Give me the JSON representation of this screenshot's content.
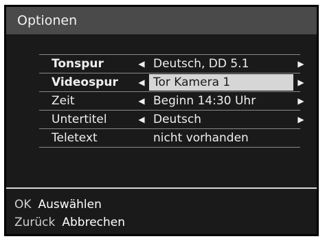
{
  "window": {
    "title": "Optionen"
  },
  "options": [
    {
      "label": "Tonspur",
      "value": "Deutsch, DD 5.1",
      "bold": true
    },
    {
      "label": "Videospur",
      "value": "Tor Kamera 1",
      "bold": true,
      "selected": true
    },
    {
      "label": "Zeit",
      "value": "Beginn 14:30 Uhr",
      "bold": false
    },
    {
      "label": "Untertitel",
      "value": "Deutsch",
      "bold": false
    },
    {
      "label": "Teletext",
      "value": "nicht vorhanden",
      "bold": false
    }
  ],
  "footer": {
    "ok_key": "OK",
    "ok_action": "Auswählen",
    "back_key": "Zurück",
    "back_action": "Abbrechen"
  },
  "icons": {
    "left": "arrow-left-icon",
    "right": "arrow-right-icon"
  },
  "colors": {
    "background": "#1a1a1a",
    "titlebar": "#4a4a4a",
    "highlight": "#d6d6d6",
    "text": "#efefef"
  }
}
